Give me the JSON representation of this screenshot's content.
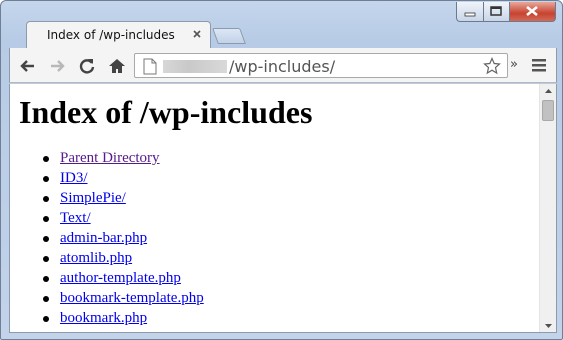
{
  "tab": {
    "title": "Index of /wp-includes",
    "close_icon": "close-icon"
  },
  "toolbar": {
    "url_path": "/wp-includes/",
    "extensions_more": "»",
    "icons": [
      "back-arrow-icon",
      "forward-arrow-icon",
      "reload-icon",
      "home-icon",
      "page-icon",
      "star-icon",
      "hamburger-menu-icon"
    ]
  },
  "page": {
    "heading": "Index of /wp-includes",
    "links": [
      {
        "label": "Parent Directory",
        "visited": true
      },
      {
        "label": "ID3/",
        "visited": false
      },
      {
        "label": "SimplePie/",
        "visited": false
      },
      {
        "label": "Text/",
        "visited": false
      },
      {
        "label": "admin-bar.php",
        "visited": false
      },
      {
        "label": "atomlib.php",
        "visited": false
      },
      {
        "label": "author-template.php",
        "visited": false
      },
      {
        "label": "bookmark-template.php",
        "visited": false
      },
      {
        "label": "bookmark.php",
        "visited": false
      }
    ]
  },
  "colors": {
    "link": "#0000ee",
    "visited_link": "#551a8b",
    "frame": "#b7cbe6"
  }
}
